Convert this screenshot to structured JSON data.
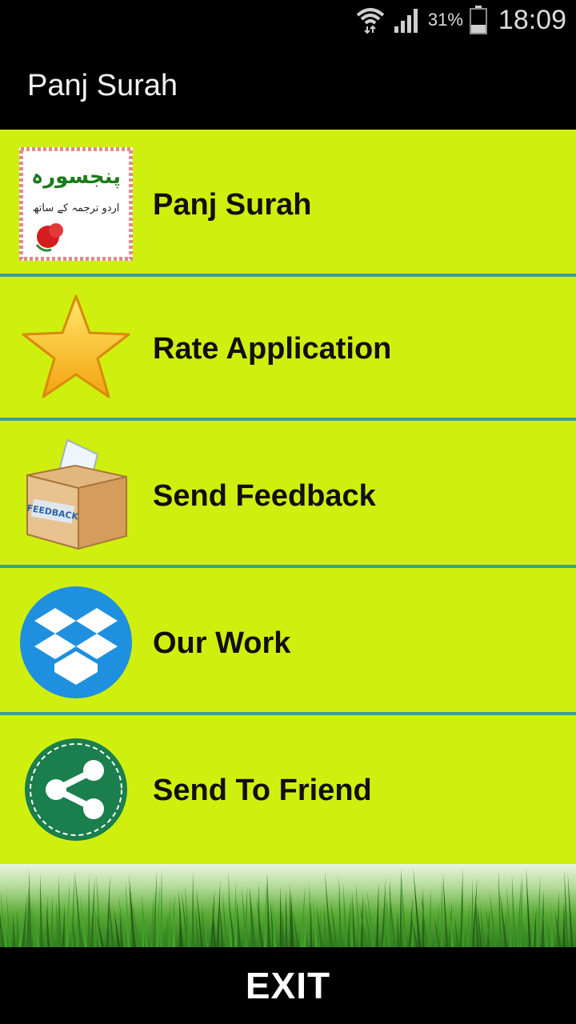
{
  "status_bar": {
    "battery_percent": "31%",
    "time": "18:09",
    "icons": [
      "wifi-icon",
      "signal-icon",
      "battery-icon"
    ]
  },
  "app_bar": {
    "title": "Panj Surah"
  },
  "menu": {
    "background_color": "#cfef0f",
    "divider_color": "#3aa28c",
    "items": [
      {
        "label": "Panj Surah",
        "icon": "panj-surah-logo-icon"
      },
      {
        "label": "Rate Application",
        "icon": "star-icon"
      },
      {
        "label": "Send Feedback",
        "icon": "feedback-box-icon"
      },
      {
        "label": "Our Work",
        "icon": "dropbox-icon"
      },
      {
        "label": "Send To Friend",
        "icon": "share-icon"
      }
    ]
  },
  "logo": {
    "urdu_title": "پنجسورہ",
    "urdu_subtitle": "اردو ترجمہ کے ساتھ",
    "box_text": "FEEDBACK"
  },
  "footer": {
    "exit_label": "EXIT"
  }
}
